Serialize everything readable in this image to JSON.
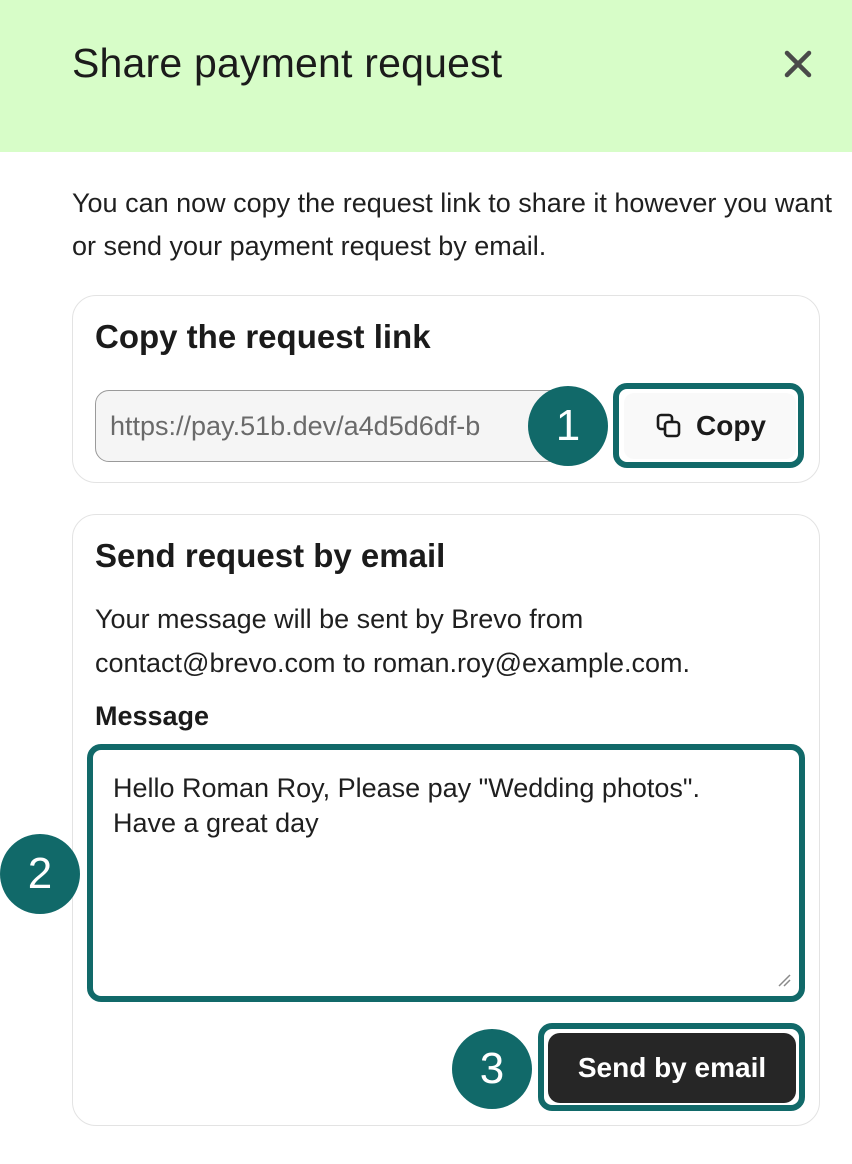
{
  "header": {
    "title": "Share payment request",
    "close_icon": "close-icon",
    "background_color": "#d7fdc8"
  },
  "intro": {
    "text": "You can now copy the request link to share it however you want or send your payment request by email."
  },
  "copy_section": {
    "title": "Copy the request link",
    "link_value": "https://pay.51b.dev/a4d5d6df-b",
    "copy_label": "Copy",
    "copy_icon": "copy-icon"
  },
  "email_section": {
    "title": "Send request by email",
    "description": "Your message will be sent by Brevo from contact@brevo.com to roman.roy@example.com.",
    "message_label": "Message",
    "message_value": "Hello Roman Roy, Please pay \"Wedding photos\".\nHave a great day",
    "send_label": "Send by email"
  },
  "annotations": {
    "step1": "1",
    "step2": "2",
    "step3": "3",
    "color": "#116969"
  }
}
